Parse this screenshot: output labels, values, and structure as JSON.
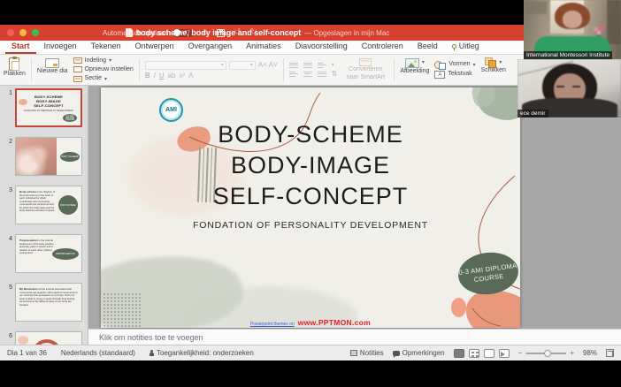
{
  "titlebar": {
    "autosave_label": "Automatisch opslaan",
    "autosave_state": "UIT",
    "doc_title": "body scheme, body image and self-concept",
    "saved_suffix": "— Opgeslagen in mijn Mac"
  },
  "tabs": [
    "Start",
    "Invoegen",
    "Tekenen",
    "Ontwerpen",
    "Overgangen",
    "Animaties",
    "Diavoorstelling",
    "Controleren",
    "Beeld",
    "Uitleg"
  ],
  "ribbon": {
    "plakken_label": "Plakken",
    "nieuwe_dia_label": "Nieuwe dia",
    "indeling_label": "Indeling",
    "opnieuw_label": "Opnieuw instellen",
    "sectie_label": "Sectie",
    "bold": "B",
    "italic": "I",
    "underline": "U",
    "converteren_label": "Converteren naar SmartArt",
    "afbeelding_label": "Afbeelding",
    "vormen_label": "Vormen",
    "tekstvak_label": "Tekstvak",
    "schikken_label": "Schikken"
  },
  "thumbnails": [
    {
      "num": "1",
      "line1": "BODY-SCHEME",
      "line2": "BODY-IMAGE",
      "line3": "SELF-CONCEPT",
      "sub": "FONDATION OF PERSONALITY DEVELOPMENT",
      "badge": "0-3 AMI DIPLOMA COURSE"
    },
    {
      "num": "2",
      "badge": "BODY SCHEME"
    },
    {
      "num": "3",
      "lead": "Body scheme",
      "body": " is the diagram of the body built up in the brain of each individual by which coordinates and successive movements are carried out and by which the body parts and the body itself are oriented in space.",
      "badge": "BODY-SCHEME"
    },
    {
      "num": "4",
      "lead": "Proprioception",
      "body": " is the internal awareness of the body position, and body parts in space and in relation to each other, without seeing them",
      "badge": "PROPRIOCEPTION"
    },
    {
      "num": "5",
      "lead": "My Movements",
      "body": " All the internal associations/all movements get together, with required movements in our mind are first perception of our body. Once our body is able to move in space through kind feeling, we know how the different parts of our body are situated."
    },
    {
      "num": "6"
    }
  ],
  "slide": {
    "logo_text": "AMI",
    "title_line1": "BODY-SCHEME",
    "title_line2": "BODY-IMAGE",
    "title_line3": "SELF-CONCEPT",
    "subtitle": "FONDATION OF PERSONALITY DEVELOPMENT",
    "badge_line1": "0-3 AMI DIPLOMA",
    "badge_line2": "COURSE",
    "credit_prefix": "Powerpoint themes on",
    "credit_link": "www.PPTMON.com"
  },
  "notes_placeholder": "Klik om notities toe te voegen",
  "statusbar": {
    "slide_info": "Dia 1 van 36",
    "language": "Nederlands (standaard)",
    "accessibility": "Toegankelijkheid: onderzoeken",
    "notes_label": "Notities",
    "comments_label": "Opmerkingen",
    "zoom_pct": "98%"
  },
  "videos": [
    {
      "name": "International Montessori Institute"
    },
    {
      "name": "ece demir"
    }
  ],
  "colors": {
    "titlebar_red": "#d6402f",
    "accent_red": "#c0392b",
    "slide_green": "#5a6a59",
    "salmon": "#e99c80",
    "slide_cream": "#f1efe9"
  }
}
